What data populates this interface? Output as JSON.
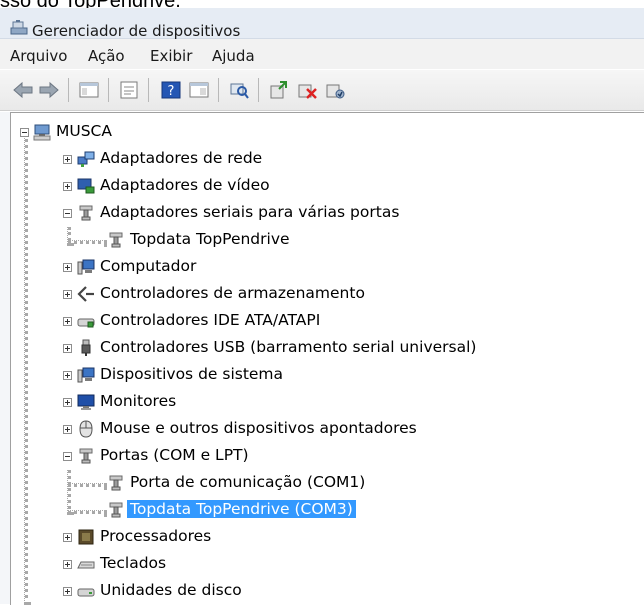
{
  "doc": {
    "cut_text": "sso do TopPendrive."
  },
  "window": {
    "title": "Gerenciador de dispositivos"
  },
  "menu": [
    "Arquivo",
    "Ação",
    "Exibir",
    "Ajuda"
  ],
  "toolbar": {
    "buttons": [
      "back-arrow-icon",
      "forward-arrow-icon",
      "console-tree-icon",
      "properties-icon",
      "help-icon",
      "view-icon",
      "scan-hardware-icon",
      "update-driver-icon",
      "uninstall-icon",
      "disable-icon"
    ]
  },
  "tree": {
    "root": "MUSCA",
    "items": [
      "Adaptadores de rede",
      "Adaptadores de vídeo",
      "Adaptadores seriais para várias portas",
      "Topdata TopPendrive",
      "Computador",
      "Controladores de armazenamento",
      "Controladores IDE ATA/ATAPI",
      "Controladores USB (barramento serial universal)",
      "Dispositivos de sistema",
      "Monitores",
      "Mouse e outros dispositivos apontadores",
      "Portas (COM e LPT)",
      "Porta de comunicação (COM1)",
      "Topdata TopPendrive (COM3)",
      "Processadores",
      "Teclados",
      "Unidades de disco"
    ],
    "selected": "Topdata TopPendrive (COM3)"
  },
  "colors": {
    "selection": "#3399ff",
    "titlebar": "#e6ecf4"
  }
}
